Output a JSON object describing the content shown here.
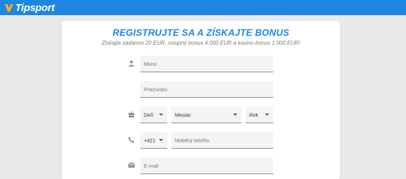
{
  "header": {
    "brand": "Tipsport",
    "brand_color": "#1f86e3",
    "logo_icon": "tipsport-v-logo-icon"
  },
  "form": {
    "title": "REGISTRUJTE SA A ZÍSKAJTE BONUS",
    "subtitle": "Získajte zadarmo 20 EUR, vstupný bonus 4 000 EUR a kasino bonus 1 000 EUR!",
    "first_name_placeholder": "Meno",
    "last_name_placeholder": "Priezvisko",
    "birth_day": "Deň",
    "birth_month": "Mesiac",
    "birth_year": "Rok",
    "phone_prefix": "+421",
    "phone_placeholder": "Mobilný telefón",
    "email_placeholder": "E-mail",
    "icons": [
      "person-icon",
      "birthday-cake-icon",
      "phone-icon",
      "email-icon"
    ]
  }
}
